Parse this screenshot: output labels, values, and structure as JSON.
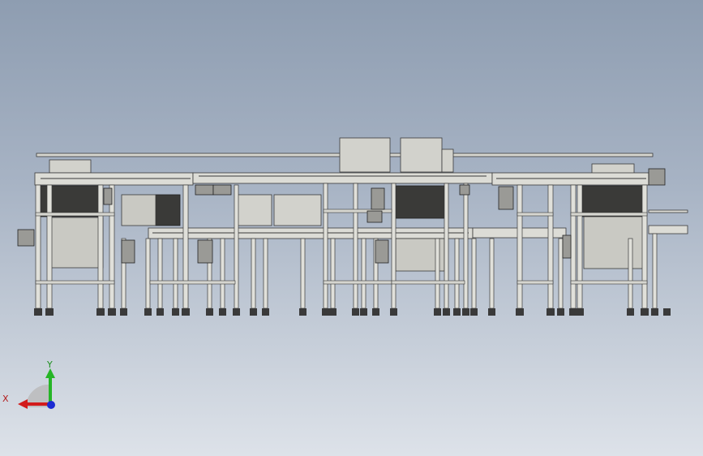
{
  "viewport": {
    "background_top": "#8e9db1",
    "background_bottom": "#dde2e9"
  },
  "model": {
    "steel": "#d6d6d0",
    "shadow": "#2f2f2f",
    "line": "#3a3a3a",
    "panel": "#c9c9c3"
  },
  "triad": {
    "x_label": "X",
    "y_label": "Y",
    "x_color": "#d21b1b",
    "y_color": "#26b526",
    "z_color": "#1b2bd2"
  }
}
